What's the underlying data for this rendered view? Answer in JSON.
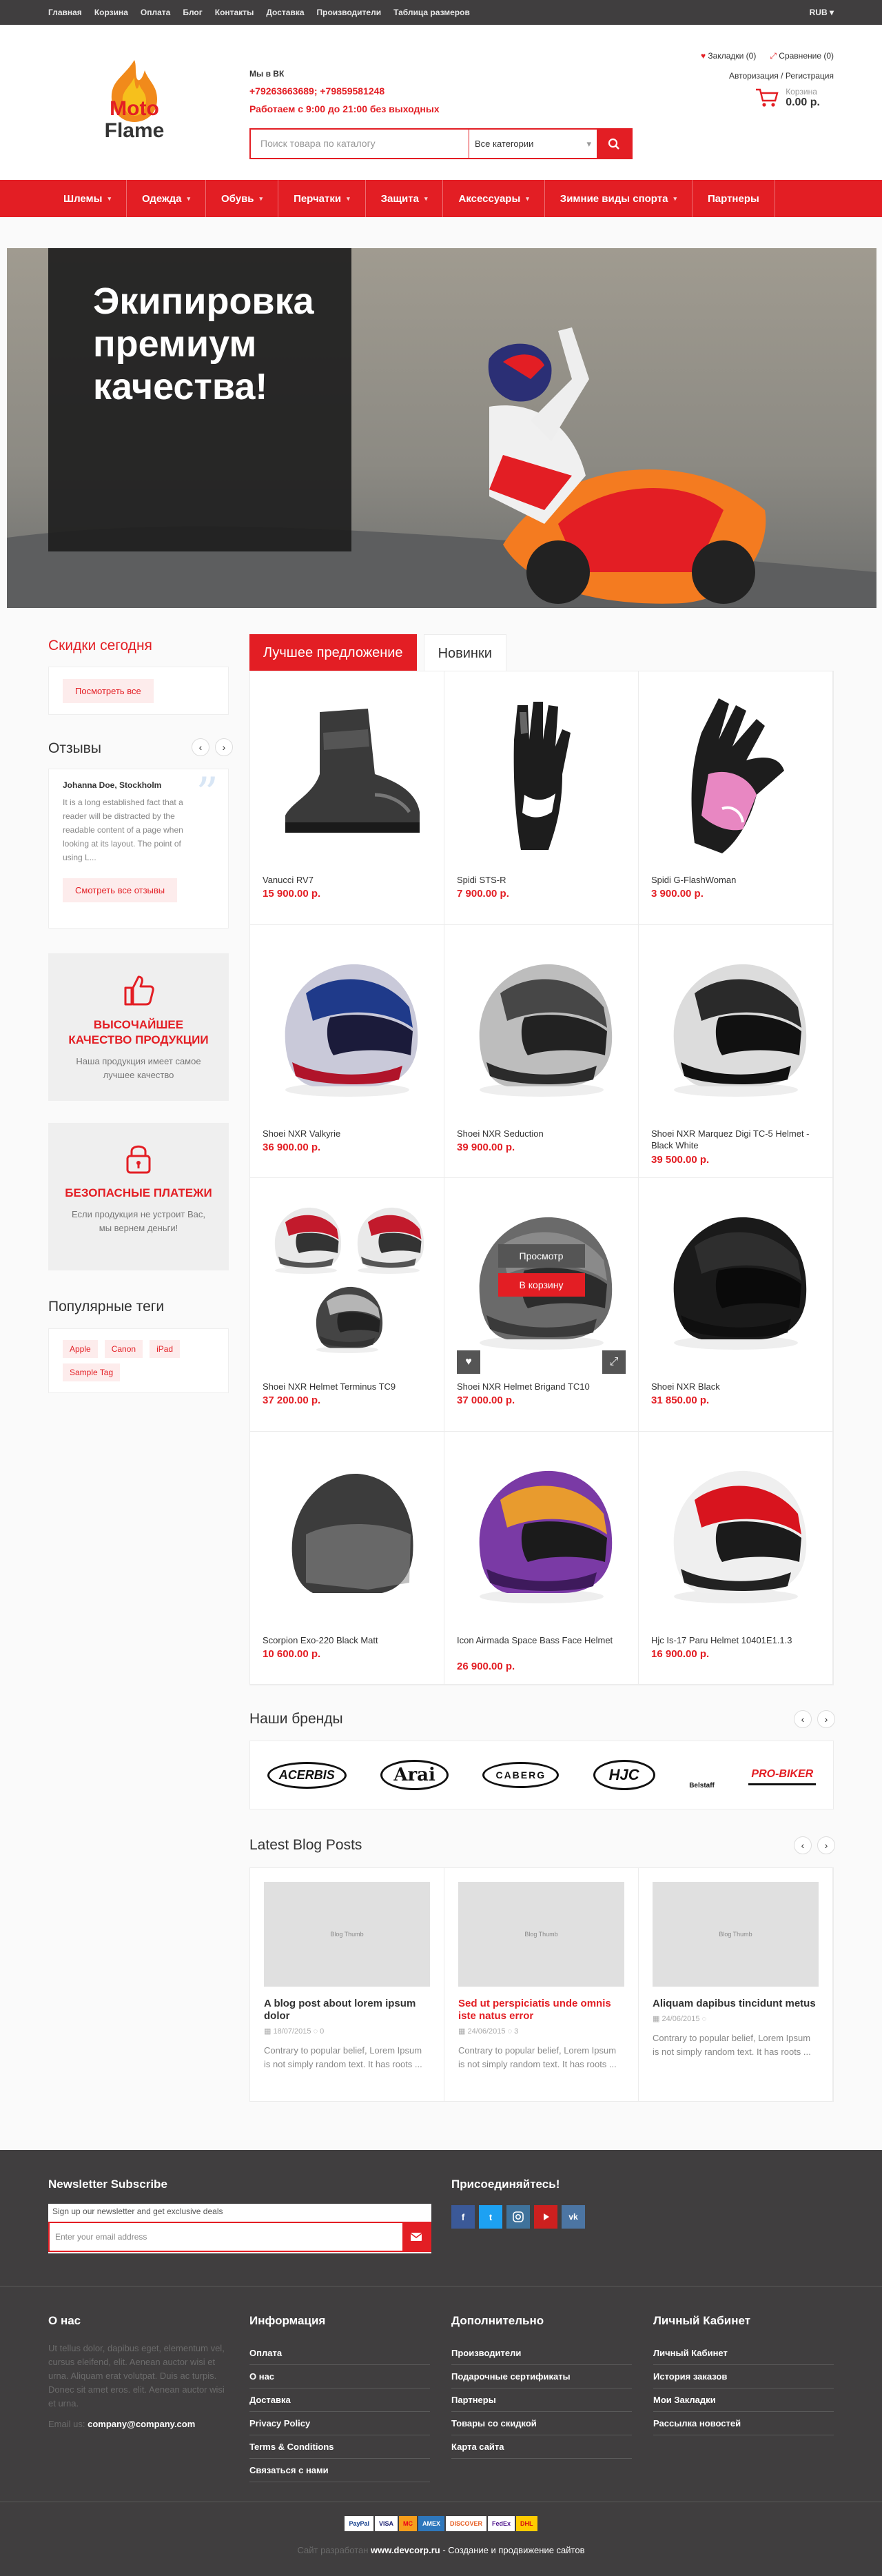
{
  "topbar": {
    "links": [
      "Главная",
      "Корзина",
      "Оплата",
      "Блог",
      "Контакты",
      "Доставка",
      "Производители",
      "Таблица размеров"
    ],
    "currency": "RUB"
  },
  "header": {
    "logo_line1": "Moto",
    "logo_line2": "Flame",
    "vk_label": "Мы в ВК",
    "phones": "+79263663689; +79859581248",
    "hours": "Работаем с 9:00 до 21:00 без выходных",
    "search_placeholder": "Поиск товара по каталогу",
    "search_category": "Все категории",
    "bookmarks": "Закладки (0)",
    "compare": "Сравнение (0)",
    "login": "Авторизация",
    "slash": "/",
    "register": "Регистрация",
    "cart_label": "Корзина",
    "cart_amount": "0.00 р."
  },
  "nav": [
    {
      "label": "Шлемы",
      "sub": true
    },
    {
      "label": "Одежда",
      "sub": true
    },
    {
      "label": "Обувь",
      "sub": true
    },
    {
      "label": "Перчатки",
      "sub": true
    },
    {
      "label": "Защита",
      "sub": true
    },
    {
      "label": "Аксессуары",
      "sub": true
    },
    {
      "label": "Зимние виды спорта",
      "sub": true
    },
    {
      "label": "Партнеры",
      "sub": false
    }
  ],
  "banner": {
    "line1": "Экипировка",
    "line2": "премиум",
    "line3": "качества!"
  },
  "sidebar": {
    "discounts_title": "Скидки сегодня",
    "discounts_btn": "Посмотреть все",
    "reviews_title": "Отзывы",
    "review_author": "Johanna Doe, Stockholm",
    "review_text": "It is a long established fact that a reader will be distracted by the readable content of a page when looking at its layout. The point of using L...",
    "reviews_btn": "Смотреть все отзывы",
    "quality_title": "ВЫСОЧАЙШЕЕ КАЧЕСТВО ПРОДУКЦИИ",
    "quality_desc": "Наша продукция имеет самое лучшее качество",
    "payment_title": "БЕЗОПАСНЫЕ ПЛАТЕЖИ",
    "payment_desc": "Если продукция не устроит Вас, мы вернем деньги!",
    "tags_title": "Популярные теги",
    "tags": [
      "Apple",
      "Canon",
      "iPad",
      "Sample Tag"
    ]
  },
  "tabs": {
    "best": "Лучшее предложение",
    "new": "Новинки"
  },
  "products": [
    {
      "name": "Vanucci RV7",
      "price": "15 900.00 р.",
      "kind": "boot"
    },
    {
      "name": "Spidi STS-R",
      "price": "7 900.00 р.",
      "kind": "glove"
    },
    {
      "name": "Spidi G-FlashWoman",
      "price": "3 900.00 р.",
      "kind": "glove-pink"
    },
    {
      "name": "Shoei NXR Valkyrie",
      "price": "36 900.00 р.",
      "kind": "helmet-red"
    },
    {
      "name": "Shoei NXR Seduction",
      "price": "39 900.00 р.",
      "kind": "helmet-grey"
    },
    {
      "name": "Shoei NXR Marquez Digi TC-5 Helmet - Black White",
      "price": "39 500.00 р.",
      "kind": "helmet-bw"
    },
    {
      "name": "Shoei NXR Helmet Terminus TC9",
      "price": "37 200.00 р.",
      "kind": "helmet-trio"
    },
    {
      "name": "Shoei NXR Helmet Brigand TC10",
      "price": "37 000.00 р.",
      "kind": "helmet-brigand"
    },
    {
      "name": "Shoei NXR Black",
      "price": "31 850.00 р.",
      "kind": "helmet-black"
    },
    {
      "name": "Scorpion Exo-220 Black Matt",
      "price": "10 600.00 р.",
      "kind": "helmet-open"
    },
    {
      "name": "Icon Airmada Space Bass Face Helmet",
      "price": "26 900.00 р.",
      "kind": "helmet-space"
    },
    {
      "name": "Hjc Is-17 Paru Helmet 10401E1.1.3",
      "price": "16 900.00 р.",
      "kind": "helmet-hjc"
    }
  ],
  "hover": {
    "view": "Просмотр",
    "cart": "В корзину"
  },
  "brands_title": "Наши бренды",
  "brands": [
    "ACERBIS",
    "Arai",
    "CABERG",
    "HJC",
    "Belstaff",
    "PRO-BIKER"
  ],
  "blog_title": "Latest Blog Posts",
  "blog_thumb": "Blog Thumb",
  "blog": [
    {
      "title": "A blog post about lorem ipsum dolor",
      "date": "18/07/2015",
      "comments": "0",
      "text": "Contrary to popular belief, Lorem Ipsum is not simply random text. It has roots ...",
      "red": false
    },
    {
      "title": "Sed ut perspiciatis unde omnis iste natus error",
      "date": "24/06/2015",
      "comments": "3",
      "text": "Contrary to popular belief, Lorem Ipsum is not simply random text. It has roots ...",
      "red": true
    },
    {
      "title": "Aliquam dapibus tincidunt metus",
      "date": "24/06/2015",
      "comments": "",
      "text": "Contrary to popular belief, Lorem Ipsum is not simply random text. It has roots ...",
      "red": false
    }
  ],
  "newsletter": {
    "title": "Newsletter Subscribe",
    "desc": "Sign up our newsletter and get exclusive deals",
    "placeholder": "Enter your email address",
    "join": "Присоединяйтесь!"
  },
  "footer": {
    "about_title": "О нас",
    "about_text": "Ut tellus dolor, dapibus eget, elementum vel, cursus eleifend, elit. Aenean auctor wisi et urna. Aliquam erat volutpat. Duis ac turpis. Donec sit amet eros. elit. Aenean auctor wisi et urna.",
    "email_label": "Email us:",
    "email": "company@company.com",
    "info_title": "Информация",
    "info_links": [
      "Оплата",
      "О нас",
      "Доставка",
      "Privacy Policy",
      "Terms & Conditions",
      "Связаться с нами"
    ],
    "extra_title": "Дополнительно",
    "extra_links": [
      "Производители",
      "Подарочные сертификаты",
      "Партнеры",
      "Товары со скидкой",
      "Карта сайта"
    ],
    "account_title": "Личный Кабинет",
    "account_links": [
      "Личный Кабинет",
      "История заказов",
      "Мои Закладки",
      "Рассылка новостей"
    ]
  },
  "bottom": {
    "payments": [
      "PayPal",
      "VISA",
      "MC",
      "AMEX",
      "DISCOVER",
      "FedEx",
      "DHL"
    ],
    "dev_prefix": "Сайт разработан",
    "dev_site": "www.devcorp.ru",
    "dev_suffix": " - Создание и продвижение сайтов"
  },
  "colors": {
    "accent": "#e31e24",
    "dark": "#403e3f"
  }
}
